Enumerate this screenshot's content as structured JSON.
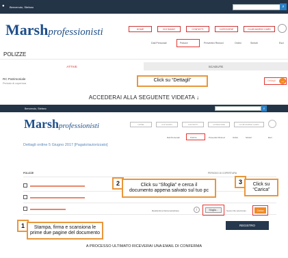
{
  "panel1": {
    "topbar": {
      "user": "Benvenuto, Stefano",
      "search_btn": "🔍"
    },
    "logo": {
      "brand": "Marsh",
      "suffix": "professionisti"
    },
    "nav": [
      "HOME",
      "CHI SIAMO",
      "CONTATTI",
      "CATEGORIE",
      "CLUB MARSH CARD"
    ],
    "subnav": [
      "Dati Personali",
      "Polizze",
      "Preventivi Rinnovi",
      "Ordini",
      "Sinistri",
      "Esci"
    ],
    "page_title": "POLIZZE",
    "tabs": {
      "active": "ATTIVE",
      "inactive": "SCADUTE"
    },
    "row": {
      "title": "RC Patrimoniale",
      "subtitle": "Periodo di copertura",
      "action": "Dettagli"
    },
    "callout": "Click su “Dettagli”"
  },
  "divider_text": "ACCEDERAI ALLA SEGUENTE VIDEATA ↓",
  "panel2": {
    "topbar": {
      "user": "Benvenuto, Stefano",
      "search_btn": "🔍"
    },
    "logo": {
      "brand": "Marsh",
      "suffix": "professionisti"
    },
    "nav": [
      "HOME",
      "CHI SIAMO",
      "CONTATTI",
      "CATEGORIE",
      "CLUB MARSH CARD"
    ],
    "subnav": [
      "Dati Personali",
      "Polizze",
      "Preventivi Rinnovi",
      "Ordini",
      "Sinistri",
      "Esci"
    ],
    "page_title": "Dettagli ordine 5 Giugno 2017 [Pagato/autorizzato]",
    "section_left": "POLIZZE",
    "section_right": "PERIODO DI COPERTURA",
    "upload_label": "Restituzione Documentazione",
    "browse_btn": "Sfoglia...",
    "file_note": "Nessun file selezionato",
    "upload_btn": "Carica",
    "register_btn": "REGISTRO",
    "callouts": {
      "c1": {
        "num": "1",
        "text_line1": "Stampa, firma e scansiona le",
        "text_line2": "prime due pagine del documento"
      },
      "c2": {
        "num": "2",
        "text_line1": "Click su “Sfoglia” e cerca il",
        "text_line2": "documento appena salvato sul tuo pc"
      },
      "c3": {
        "num": "3",
        "text_line1": "Click su",
        "text_line2": "“Carica”"
      }
    }
  },
  "footer_text": "A PROCESSO ULTIMATO RICEVERAI UNA EMAIL DI CONFERMA",
  "colors": {
    "topbar": "#243447",
    "accent_orange": "#e8963a",
    "highlight_red": "#e3342f",
    "brand_blue": "#1f4f8a"
  }
}
